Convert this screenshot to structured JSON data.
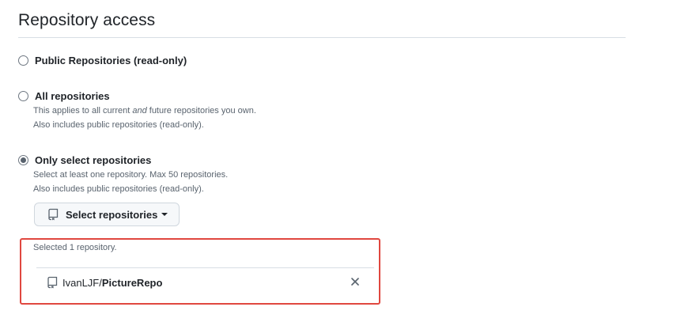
{
  "section": {
    "title": "Repository access"
  },
  "options": [
    {
      "label": "Public Repositories (read-only)",
      "checked": false
    },
    {
      "label": "All repositories",
      "checked": false,
      "desc_prefix": "This applies to all current ",
      "desc_em": "and",
      "desc_suffix": " future repositories you own.",
      "desc2": "Also includes public repositories (read-only)."
    },
    {
      "label": "Only select repositories",
      "checked": true,
      "desc1": "Select at least one repository. Max 50 repositories.",
      "desc2": "Also includes public repositories (read-only)."
    }
  ],
  "select_button": {
    "label": "Select repositories",
    "icon": "repo-icon"
  },
  "selection": {
    "count_text": "Selected 1 repository.",
    "repos": [
      {
        "owner": "IvanLJF/",
        "name": "PictureRepo",
        "icon": "repo-icon",
        "remove_icon": "close-icon"
      }
    ],
    "highlight_color": "#e0473f"
  }
}
